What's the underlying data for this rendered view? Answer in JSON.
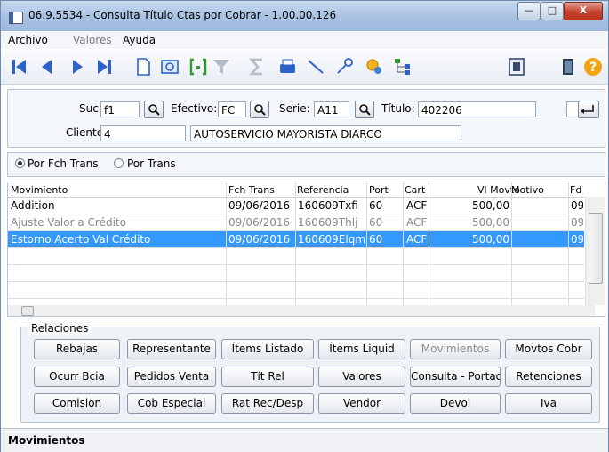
{
  "window": {
    "title": "06.9.5534 - Consulta Título Ctas por Cobrar - 1.00.00.126",
    "min": "—",
    "max": "□",
    "close": "X"
  },
  "menu": [
    "Archivo",
    "Valores",
    "Ayuda"
  ],
  "toolbar": {
    "icons": [
      "first-record-icon",
      "prev-record-icon",
      "next-record-icon",
      "last-record-icon",
      "new-document-icon",
      "preview-icon",
      "bracket-field-icon",
      "filter-icon",
      "sum-icon",
      "print-icon",
      "line-icon",
      "key-icon",
      "coin-search-icon",
      "tree-icon",
      "report-icon",
      "exit-door-icon",
      "help-icon"
    ]
  },
  "filters": {
    "suc_label": "Suc:",
    "suc_value": "f1",
    "efectivo_label": "Efectivo:",
    "efectivo_value": "FC",
    "serie_label": "Serie:",
    "serie_value": "A11",
    "titulo_label": "Título:",
    "titulo_value": "402206",
    "cliente_label": "Cliente:",
    "cliente_value": "4",
    "cliente_name": "AUTOSERVICIO MAYORISTA DIARCO"
  },
  "options": {
    "opt1": "Por Fch Trans",
    "opt2": "Por Trans",
    "selected": "Por Fch Trans"
  },
  "grid": {
    "headers": [
      "Movimiento",
      "Fch Trans",
      "Referencia",
      "Port",
      "Cart",
      "Vl Movto",
      "Motivo",
      "Fd"
    ],
    "rows": [
      [
        "Addition",
        "09/06/2016",
        "160609Txfi",
        "60",
        "ACF",
        "500,00",
        "",
        "09"
      ],
      [
        "Ajuste Valor a Crédito",
        "09/06/2016",
        "160609Thlj",
        "60",
        "ACF",
        "500,00",
        "",
        "09"
      ],
      [
        "Estorno Acerto Val Crédito",
        "09/06/2016",
        "160609Elqm",
        "60",
        "ACF",
        "500,00",
        "",
        "09"
      ]
    ]
  },
  "relaciones": {
    "legend": "Relaciones",
    "buttons": [
      [
        "Rebajas",
        "Representante",
        "Ítems Listado",
        "Ítems Liquid",
        "Movimientos",
        "Movtos Cobr"
      ],
      [
        "Ocurr Bcia",
        "Pedidos Venta",
        "Tít Rel",
        "Valores",
        "Consulta - Portado",
        "Retenciones"
      ],
      [
        "Comision",
        "Cob Especial",
        "Rat Rec/Desp",
        "Vendor",
        "Devol",
        "Iva"
      ]
    ]
  },
  "status": "Movimientos"
}
